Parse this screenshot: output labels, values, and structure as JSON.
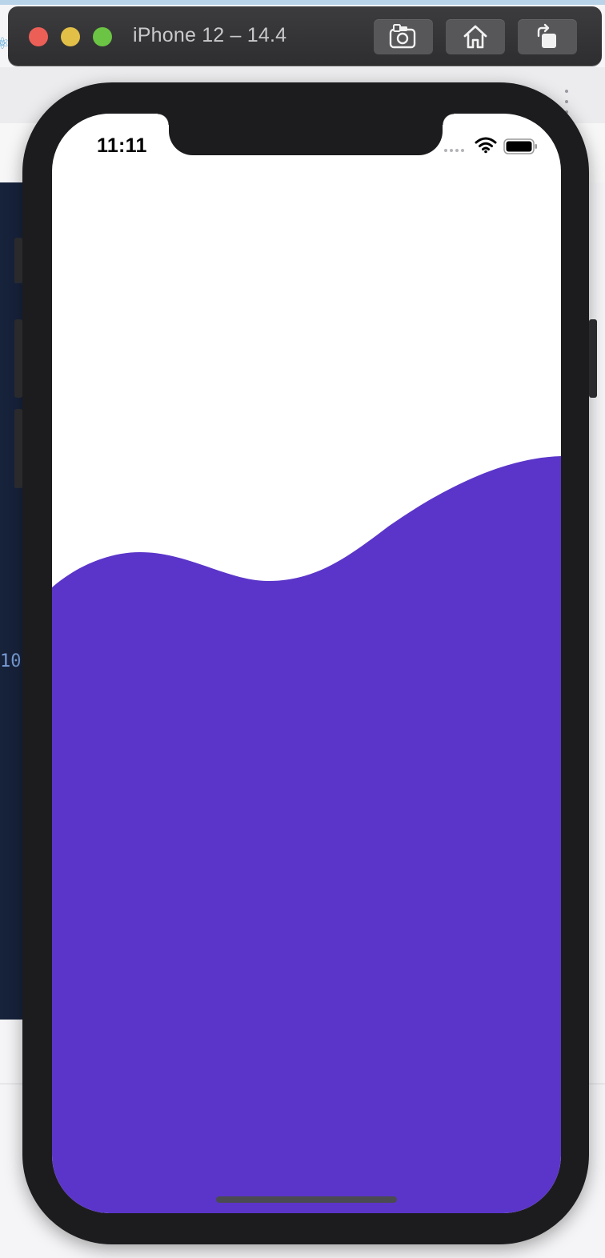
{
  "window": {
    "title": "iPhone 12 – 14.4",
    "buttons": [
      {
        "label": "Save Screen",
        "icon": "camera-icon"
      },
      {
        "label": "Home",
        "icon": "home-icon"
      },
      {
        "label": "Rotate",
        "icon": "rotate-icon"
      }
    ],
    "controls": {
      "close_color": "#ec5f57",
      "minimize_color": "#e2bf47",
      "maximize_color": "#6cc444"
    }
  },
  "status_bar": {
    "time": "11:11",
    "icons": [
      "signal-dots-icon",
      "wifi-icon",
      "battery-icon"
    ]
  },
  "app": {
    "background_color": "#ffffff",
    "wave_color": "#5b35c9"
  },
  "background_editor": {
    "partial_text": "10"
  },
  "colors": {
    "device_frame": "#1c1c1e",
    "titlebar": "#2e2e30"
  }
}
